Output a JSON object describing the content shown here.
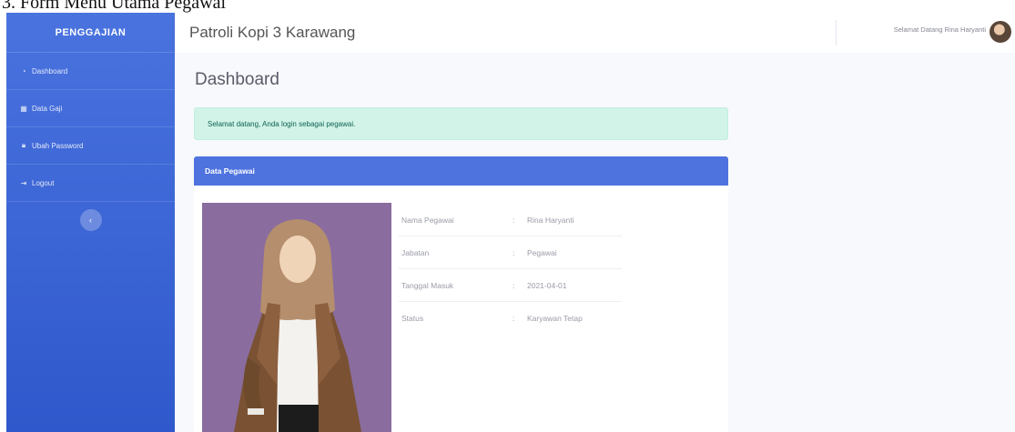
{
  "caption": "3. Form Menu Utama Pegawai",
  "sidebar": {
    "brand": "PENGGAJIAN",
    "items": [
      {
        "label": "Dashboard",
        "icon": "dashboard-icon"
      },
      {
        "label": "Data Gaji",
        "icon": "table-icon"
      },
      {
        "label": "Ubah Password",
        "icon": "lock-icon"
      },
      {
        "label": "Logout",
        "icon": "logout-icon"
      }
    ],
    "toggle_icon": "chevron-left-icon"
  },
  "topbar": {
    "title": "Patroli Kopi 3 Karawang",
    "welcome": "Selamat Datang Rina Haryanti"
  },
  "main": {
    "page_title": "Dashboard",
    "alert": "Selamat datang, Anda login sebagai pegawai.",
    "card": {
      "header": "Data Pegawai",
      "rows": [
        {
          "label": "Nama Pegawai",
          "sep": ":",
          "value": "Rina Haryanti"
        },
        {
          "label": "Jabatan",
          "sep": ":",
          "value": "Pegawai"
        },
        {
          "label": "Tanggal Masuk",
          "sep": ":",
          "value": "2021-04-01"
        },
        {
          "label": "Status",
          "sep": ":",
          "value": "Karyawan Tetap"
        }
      ]
    }
  },
  "colors": {
    "sidebar": "#4e73df",
    "alert_bg": "#d1f3e8",
    "card_header": "#4e73df",
    "photo_bg": "#8a6d9e"
  }
}
